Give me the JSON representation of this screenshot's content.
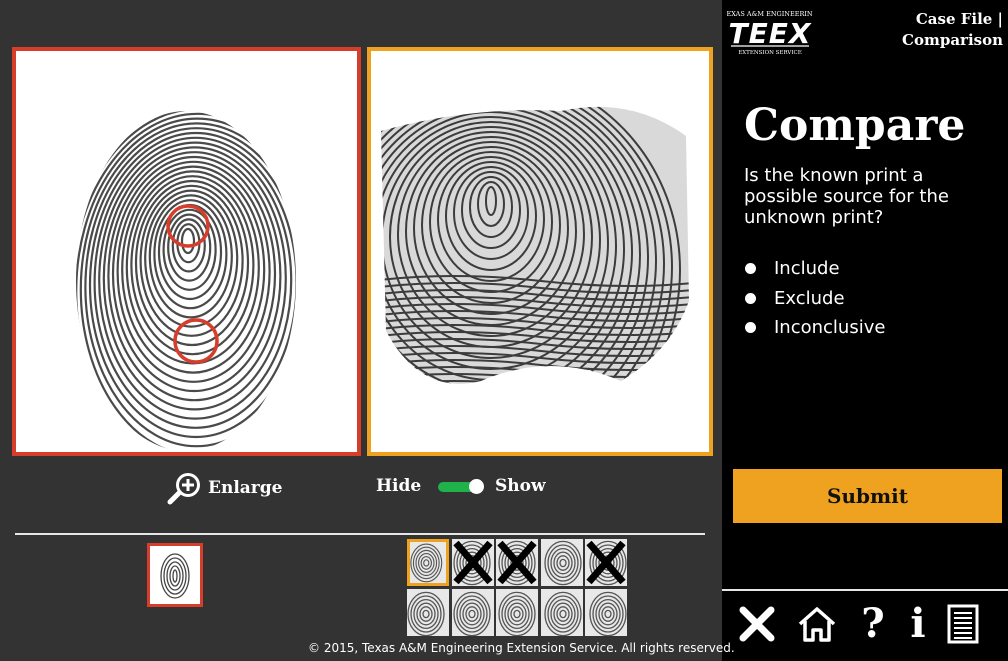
{
  "header": {
    "logo_top_text": "TEXAS A&M ENGINEERING",
    "logo_main_text": "TEEX",
    "logo_bottom_text": "EXTENSION SERVICE",
    "case_title_line1": "Case File |",
    "case_title_line2": "Comparison"
  },
  "controls": {
    "enlarge_label": "Enlarge",
    "hide_label": "Hide",
    "show_label": "Show",
    "markers_visible": true
  },
  "main": {
    "heading": "Compare",
    "question": "Is the known print a possible source for the unknown print?",
    "options": [
      {
        "label": "Include",
        "selected": false
      },
      {
        "label": "Exclude",
        "selected": false
      },
      {
        "label": "Inconclusive",
        "selected": false
      }
    ],
    "submit_label": "Submit"
  },
  "thumbnails": {
    "unknown_row1": [
      {
        "state": "selected"
      },
      {
        "state": "excluded"
      },
      {
        "state": "excluded"
      },
      {
        "state": "normal"
      },
      {
        "state": "excluded"
      }
    ],
    "unknown_row2": [
      {
        "state": "normal"
      },
      {
        "state": "normal"
      },
      {
        "state": "normal"
      },
      {
        "state": "normal"
      },
      {
        "state": "normal"
      }
    ]
  },
  "footer": {
    "copyright": "© 2015, Texas A&M Engineering Extension Service. All rights reserved."
  },
  "nav": [
    "close-icon",
    "home-icon",
    "help-icon",
    "info-icon",
    "document-icon"
  ],
  "colors": {
    "known_border": "#d63d2b",
    "unknown_border": "#efa21f",
    "submit_bg": "#efa21f",
    "toggle_on": "#1fb24b"
  }
}
